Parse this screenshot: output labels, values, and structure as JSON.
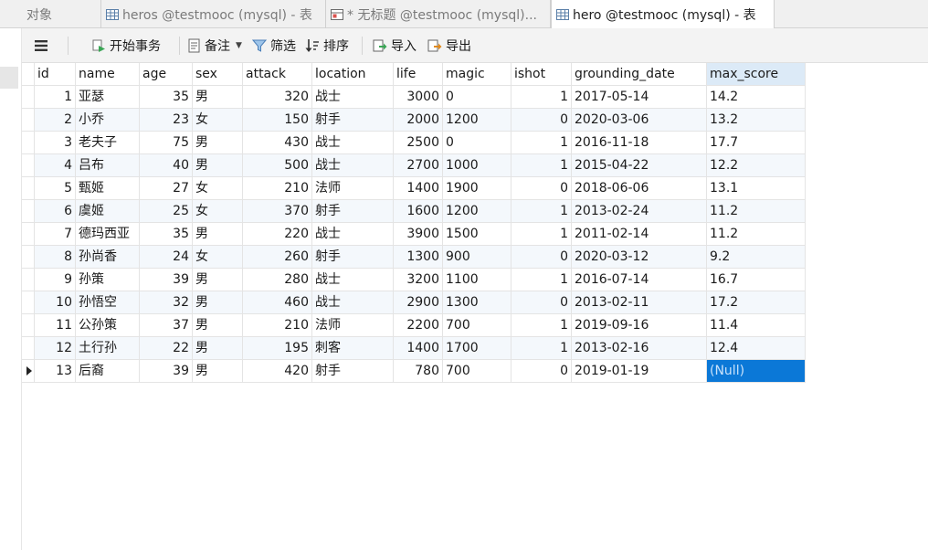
{
  "tabs": [
    {
      "label": "对象"
    },
    {
      "label": "heros @testmooc (mysql) - 表"
    },
    {
      "label": "* 无标题 @testmooc (mysql)..."
    },
    {
      "label": "hero @testmooc (mysql) - 表"
    }
  ],
  "toolbar": {
    "menu_icon": "hamburger-menu-icon",
    "begin_transaction": "开始事务",
    "memo": "备注",
    "filter": "筛选",
    "sort": "排序",
    "import": "导入",
    "export": "导出"
  },
  "table": {
    "columns": [
      "id",
      "name",
      "age",
      "sex",
      "attack",
      "location",
      "life",
      "magic",
      "ishot",
      "grounding_date",
      "max_score"
    ],
    "selected_column": "max_score",
    "rows": [
      [
        "1",
        "亚瑟",
        "35",
        "男",
        "320",
        "战士",
        "3000",
        "0",
        "1",
        "2017-05-14",
        "14.2"
      ],
      [
        "2",
        "小乔",
        "23",
        "女",
        "150",
        "射手",
        "2000",
        "1200",
        "0",
        "2020-03-06",
        "13.2"
      ],
      [
        "3",
        "老夫子",
        "75",
        "男",
        "430",
        "战士",
        "2500",
        "0",
        "1",
        "2016-11-18",
        "17.7"
      ],
      [
        "4",
        "吕布",
        "40",
        "男",
        "500",
        "战士",
        "2700",
        "1000",
        "1",
        "2015-04-22",
        "12.2"
      ],
      [
        "5",
        "甄姬",
        "27",
        "女",
        "210",
        "法师",
        "1400",
        "1900",
        "0",
        "2018-06-06",
        "13.1"
      ],
      [
        "6",
        "虞姬",
        "25",
        "女",
        "370",
        "射手",
        "1600",
        "1200",
        "1",
        "2013-02-24",
        "11.2"
      ],
      [
        "7",
        "德玛西亚",
        "35",
        "男",
        "220",
        "战士",
        "3900",
        "1500",
        "1",
        "2011-02-14",
        "11.2"
      ],
      [
        "8",
        "孙尚香",
        "24",
        "女",
        "260",
        "射手",
        "1300",
        "900",
        "0",
        "2020-03-12",
        "9.2"
      ],
      [
        "9",
        "孙策",
        "39",
        "男",
        "280",
        "战士",
        "3200",
        "1100",
        "1",
        "2016-07-14",
        "16.7"
      ],
      [
        "10",
        "孙悟空",
        "32",
        "男",
        "460",
        "战士",
        "2900",
        "1300",
        "0",
        "2013-02-11",
        "17.2"
      ],
      [
        "11",
        "公孙策",
        "37",
        "男",
        "210",
        "法师",
        "2200",
        "700",
        "1",
        "2019-09-16",
        "11.4"
      ],
      [
        "12",
        "土行孙",
        "22",
        "男",
        "195",
        "刺客",
        "1400",
        "1700",
        "1",
        "2013-02-16",
        "12.4"
      ],
      [
        "13",
        "后裔",
        "39",
        "男",
        "420",
        "射手",
        "780",
        "700",
        "0",
        "2019-01-19",
        "(Null)"
      ]
    ],
    "current_row": 13,
    "colors": {
      "selection": "#0b78d7",
      "header_selected": "#dceaf7",
      "alt_row": "#f4f8fc"
    }
  }
}
